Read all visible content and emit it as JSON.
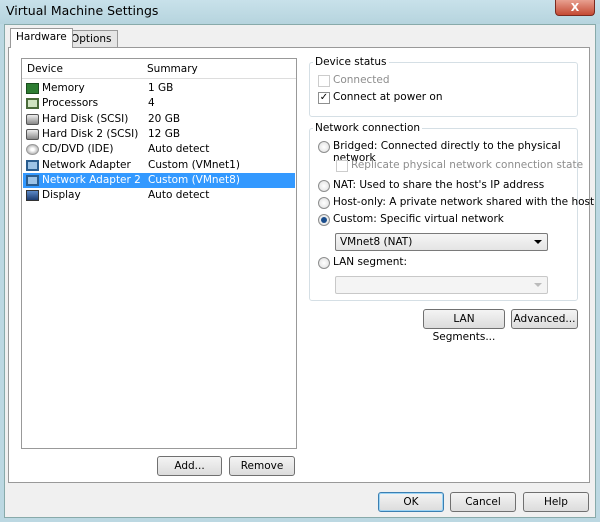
{
  "window": {
    "title": "Virtual Machine Settings",
    "close": "X"
  },
  "tabs": [
    {
      "label": "Hardware"
    },
    {
      "label": "Options"
    }
  ],
  "list": {
    "headers": {
      "device": "Device",
      "summary": "Summary"
    },
    "items": [
      {
        "device": "Memory",
        "summary": "1 GB",
        "icon": "memory-icon"
      },
      {
        "device": "Processors",
        "summary": "4",
        "icon": "processor-icon"
      },
      {
        "device": "Hard Disk (SCSI)",
        "summary": "20 GB",
        "icon": "hard-disk-icon"
      },
      {
        "device": "Hard Disk 2 (SCSI)",
        "summary": "12 GB",
        "icon": "hard-disk-icon"
      },
      {
        "device": "CD/DVD (IDE)",
        "summary": "Auto detect",
        "icon": "cd-dvd-icon"
      },
      {
        "device": "Network Adapter",
        "summary": "Custom (VMnet1)",
        "icon": "network-adapter-icon"
      },
      {
        "device": "Network Adapter 2",
        "summary": "Custom (VMnet8)",
        "icon": "network-adapter-icon",
        "selected": true
      },
      {
        "device": "Display",
        "summary": "Auto detect",
        "icon": "display-icon"
      }
    ]
  },
  "list_buttons": {
    "add": "Add...",
    "remove": "Remove"
  },
  "device_status": {
    "title": "Device status",
    "connected": "Connected",
    "connect_power": "Connect at power on"
  },
  "network": {
    "title": "Network connection",
    "bridged": "Bridged: Connected directly to the physical network",
    "replicate": "Replicate physical network connection state",
    "nat": "NAT: Used to share the host's IP address",
    "hostonly": "Host-only: A private network shared with the host",
    "custom": "Custom: Specific virtual network",
    "custom_value": "VMnet8 (NAT)",
    "lan": "LAN segment:",
    "lan_value": ""
  },
  "net_buttons": {
    "lan_segments": "LAN Segments...",
    "advanced": "Advanced..."
  },
  "footer": {
    "ok": "OK",
    "cancel": "Cancel",
    "help": "Help"
  }
}
